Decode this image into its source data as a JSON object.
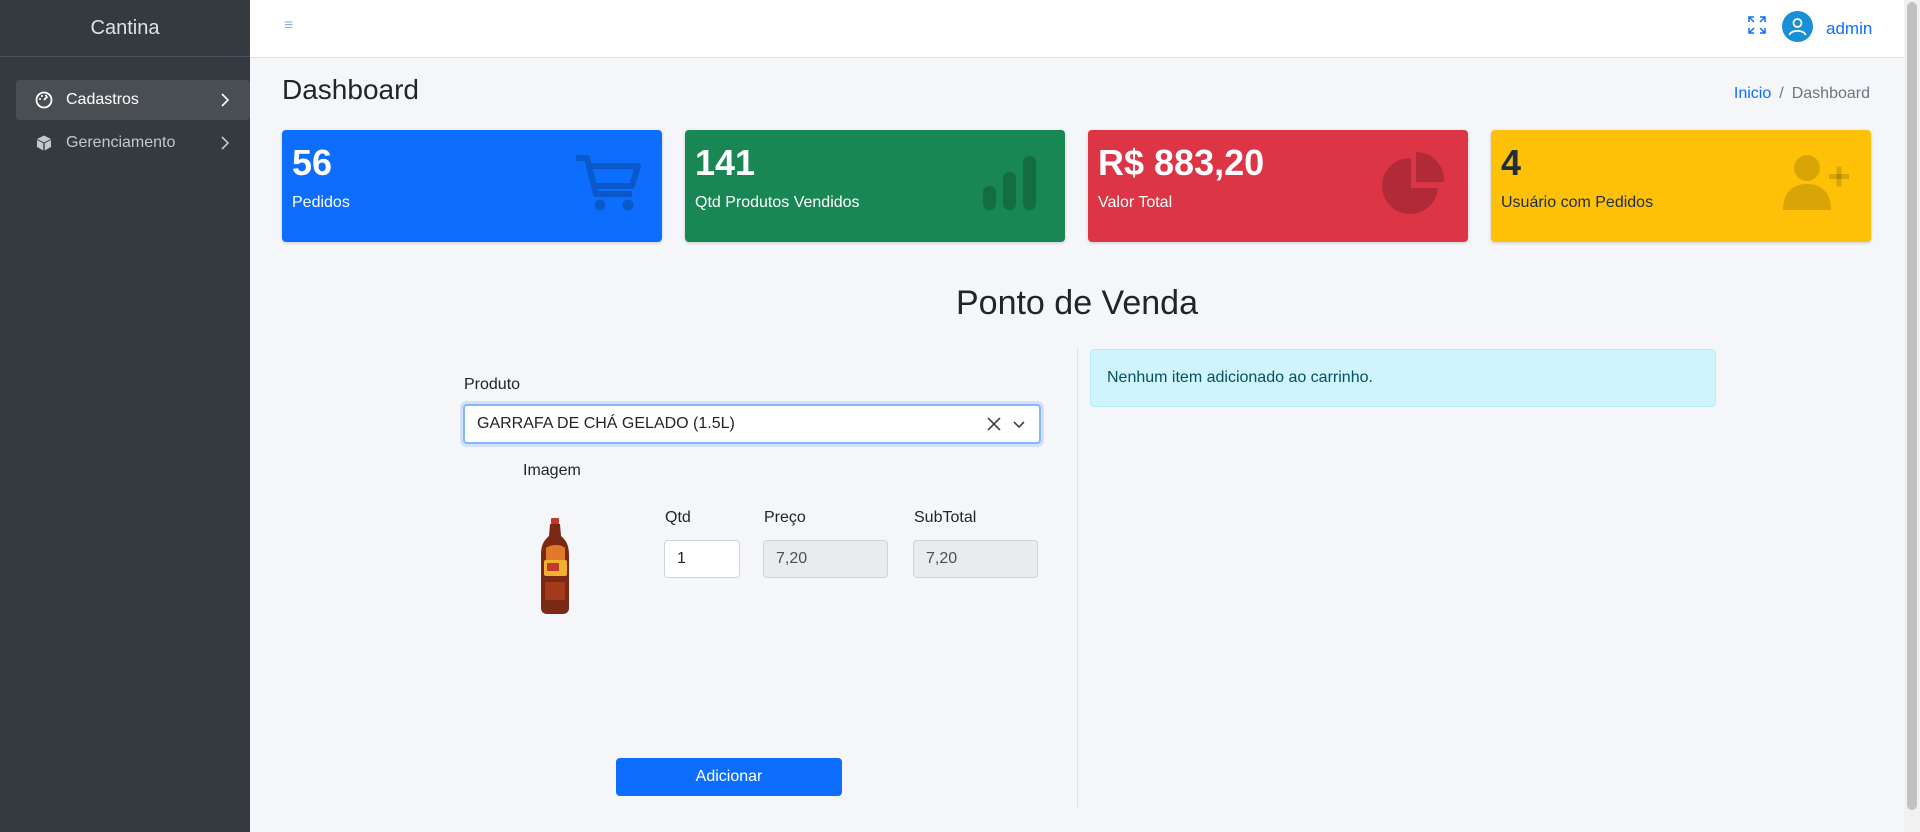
{
  "sidebar": {
    "brand": "Cantina",
    "items": [
      {
        "label": "Cadastros",
        "icon": "dashboard-gauge-icon"
      },
      {
        "label": "Gerenciamento",
        "icon": "box-icon"
      }
    ]
  },
  "topbar": {
    "menu_icon": "≡",
    "user": "admin"
  },
  "page": {
    "title": "Dashboard",
    "breadcrumb": {
      "home": "Inicio",
      "separator": "/",
      "current": "Dashboard"
    }
  },
  "stats": [
    {
      "value": "56",
      "label": "Pedidos",
      "color": "#0d6efd",
      "icon": "shopping-cart-icon"
    },
    {
      "value": "141",
      "label": "Qtd Produtos Vendidos",
      "color": "#198754",
      "icon": "bar-chart-icon"
    },
    {
      "value": "R$ 883,20",
      "label": "Valor Total",
      "color": "#dc3545",
      "icon": "pie-chart-icon"
    },
    {
      "value": "4",
      "label": "Usuário com Pedidos",
      "color": "#ffc107",
      "icon": "user-plus-icon"
    }
  ],
  "pdv": {
    "title": "Ponto de Venda",
    "produto_label": "Produto",
    "produto_selected": "GARRAFA DE CHÁ GELADO (1.5L)",
    "imagem_label": "Imagem",
    "qtd_label": "Qtd",
    "qtd_value": "1",
    "preco_label": "Preço",
    "preco_value": "7,20",
    "subtotal_label": "SubTotal",
    "subtotal_value": "7,20",
    "add_button": "Adicionar",
    "cart_empty": "Nenhum item adicionado ao carrinho."
  }
}
